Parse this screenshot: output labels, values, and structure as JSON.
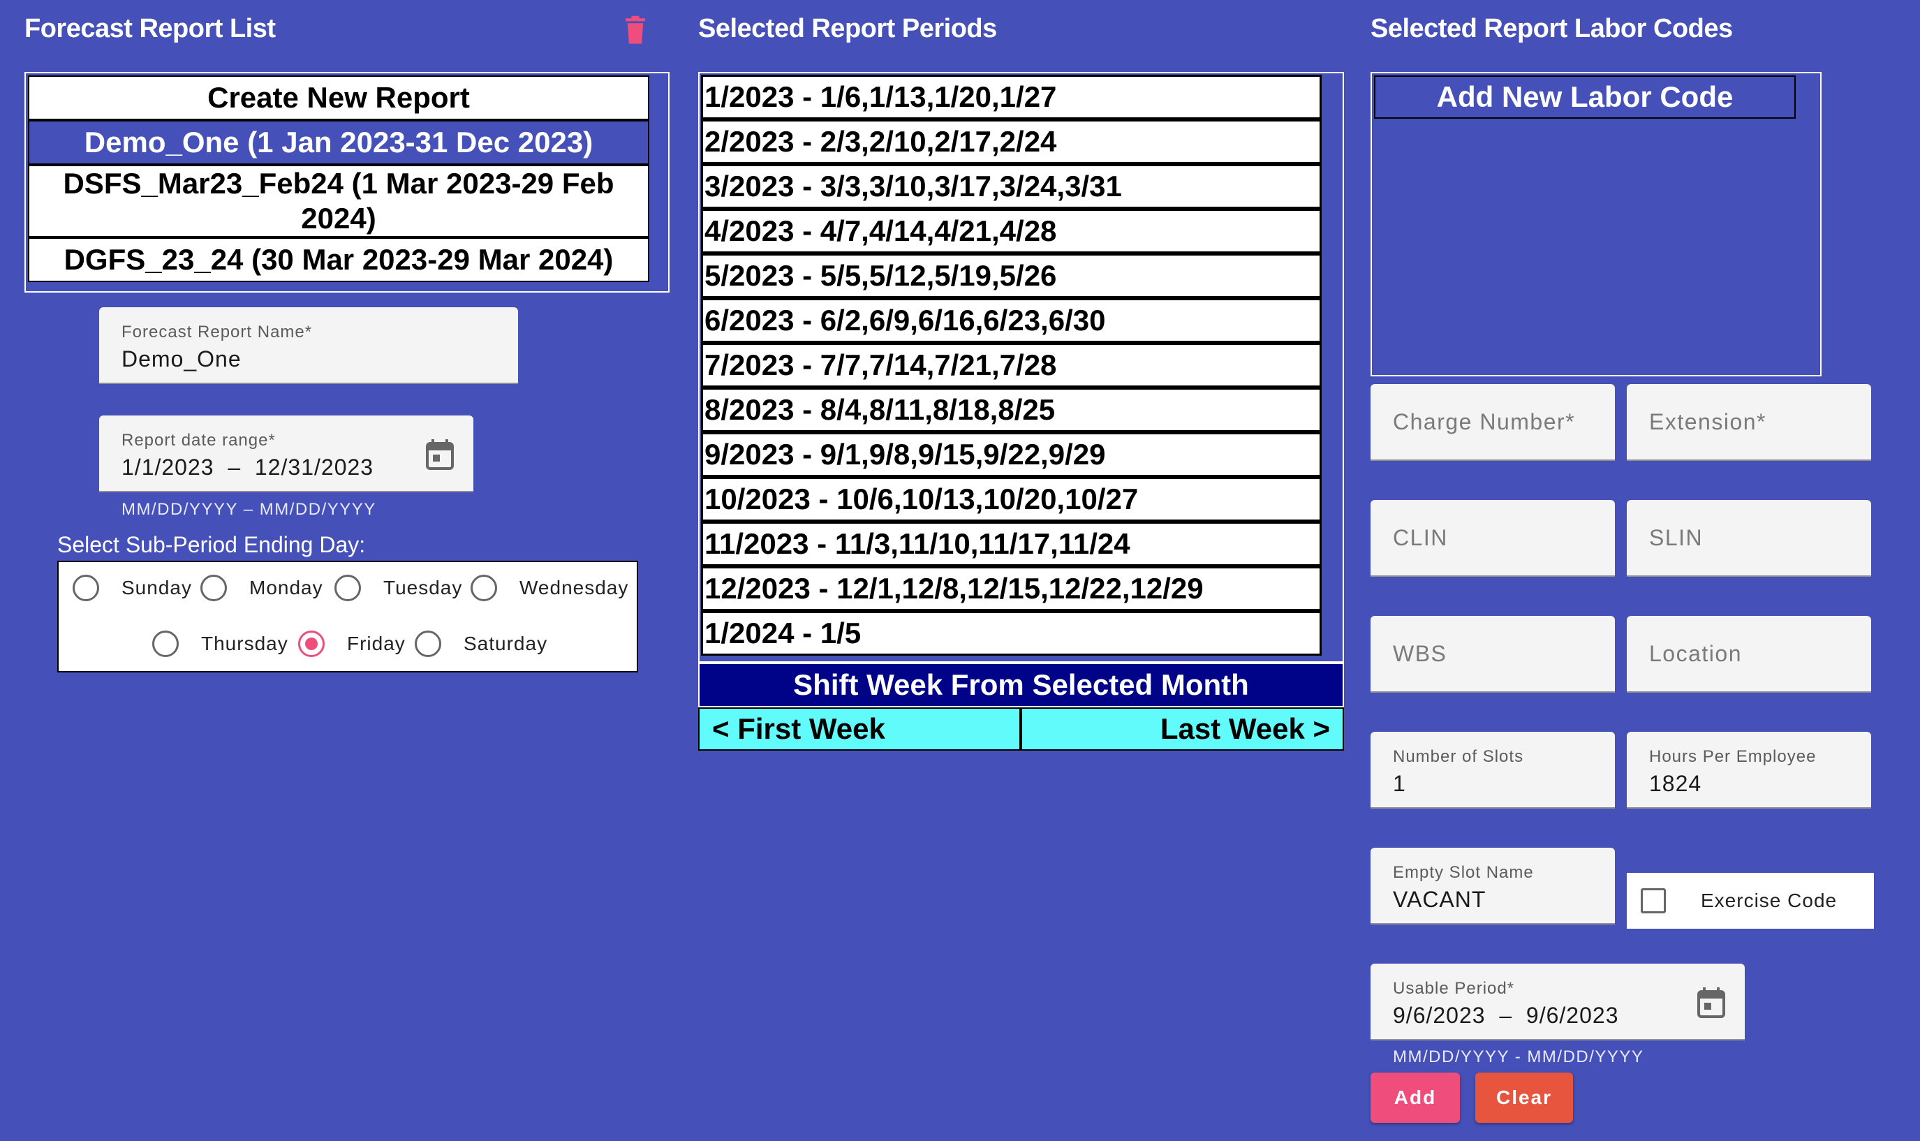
{
  "report_list": {
    "title": "Forecast Report List",
    "items": [
      {
        "label": "Create New Report"
      },
      {
        "label": "Demo_One (1 Jan 2023-31 Dec 2023)"
      },
      {
        "label": "DSFS_Mar23_Feb24 (1 Mar 2023-29 Feb 2024)"
      },
      {
        "label": "DGFS_23_24 (30 Mar 2023-29 Mar 2024)"
      }
    ],
    "selected_index": 1,
    "delete_icon": "trash-icon"
  },
  "report_name": {
    "label": "Forecast Report Name*",
    "value": "Demo_One"
  },
  "report_range": {
    "label": "Report date range*",
    "value": "1/1/2023  –  12/31/2023",
    "hint": "MM/DD/YYYY – MM/DD/YYYY",
    "icon": "calendar-icon"
  },
  "sub_period": {
    "title": "Select Sub-Period Ending Day:",
    "options": [
      "Sunday",
      "Monday",
      "Tuesday",
      "Wednesday",
      "Thursday",
      "Friday",
      "Saturday"
    ],
    "selected": "Friday"
  },
  "periods": {
    "title": "Selected Report Periods",
    "rows": [
      "1/2023 - 1/6,1/13,1/20,1/27",
      "2/2023 - 2/3,2/10,2/17,2/24",
      "3/2023 - 3/3,3/10,3/17,3/24,3/31",
      "4/2023 - 4/7,4/14,4/21,4/28",
      "5/2023 - 5/5,5/12,5/19,5/26",
      "6/2023 - 6/2,6/9,6/16,6/23,6/30",
      "7/2023 - 7/7,7/14,7/21,7/28",
      "8/2023 - 8/4,8/11,8/18,8/25",
      "9/2023 - 9/1,9/8,9/15,9/22,9/29",
      "10/2023 - 10/6,10/13,10/20,10/27",
      "11/2023 - 11/3,11/10,11/17,11/24",
      "12/2023 - 12/1,12/8,12/15,12/22,12/29",
      "1/2024 - 1/5"
    ],
    "shift_title": "Shift Week From Selected Month",
    "first_week": "< First Week",
    "last_week": "Last Week >"
  },
  "labor": {
    "title": "Selected Report Labor Codes",
    "add_label": "Add New Labor Code",
    "charge_number_placeholder": "Charge Number*",
    "extension_placeholder": "Extension*",
    "clin_placeholder": "CLIN",
    "slin_placeholder": "SLIN",
    "wbs_placeholder": "WBS",
    "location_placeholder": "Location",
    "slots_label": "Number of Slots",
    "slots_value": "1",
    "hours_label": "Hours Per Employee",
    "hours_value": "1824",
    "empty_slot_label": "Empty Slot Name",
    "empty_slot_value": "VACANT",
    "exercise_label": "Exercise Code",
    "usable_label": "Usable Period*",
    "usable_value": "9/6/2023  –  9/6/2023",
    "usable_hint": "MM/DD/YYYY - MM/DD/YYYY",
    "add_button": "Add",
    "clear_button": "Clear"
  },
  "colors": {
    "background": "#4551b8",
    "accent_pink": "#ef4d7c",
    "clear_red": "#e8553e",
    "shift_navy": "#000388",
    "cyan": "#62fbfb"
  }
}
